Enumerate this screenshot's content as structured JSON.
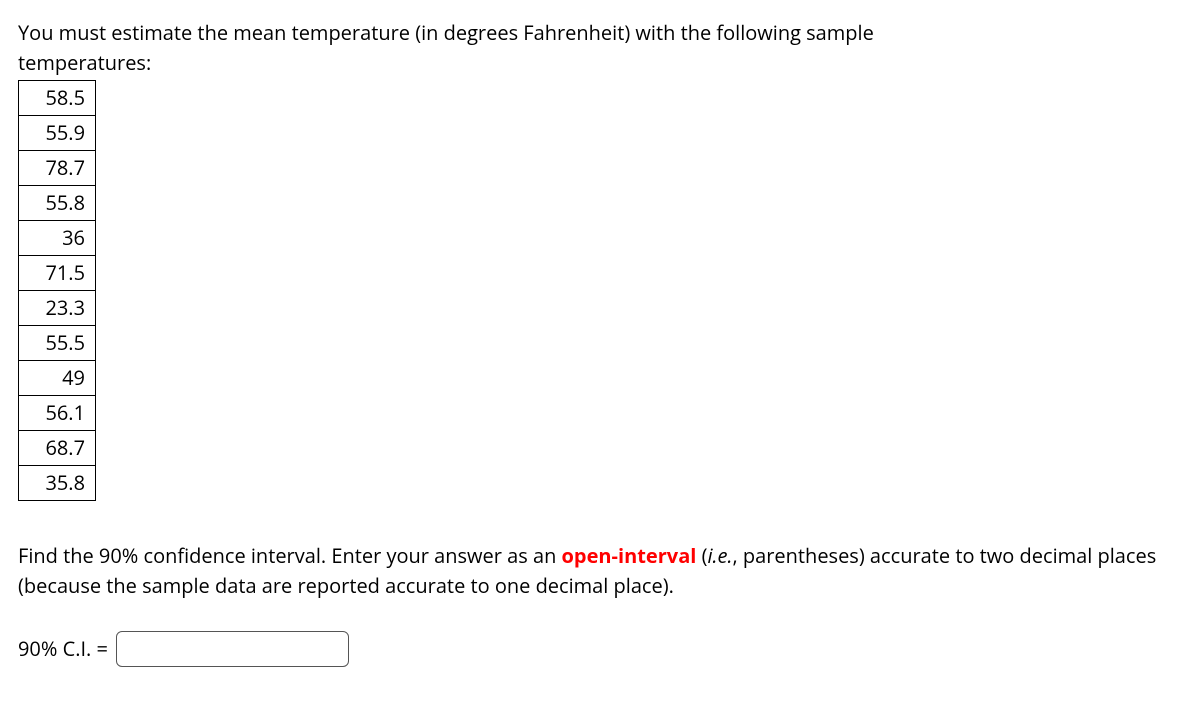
{
  "intro_line1": "You must estimate the mean temperature (in degrees Fahrenheit) with the following sample",
  "intro_line2": "temperatures:",
  "temperatures": [
    "58.5",
    "55.9",
    "78.7",
    "55.8",
    "36",
    "71.5",
    "23.3",
    "55.5",
    "49",
    "56.1",
    "68.7",
    "35.8"
  ],
  "instructions_prefix": "Find the 90% confidence interval. Enter your answer as an ",
  "open_interval_text": "open-interval",
  "instructions_mid1": " (",
  "ie_text": "i.e.",
  "instructions_mid2": ", parentheses) accurate to two decimal places (because the sample data are reported accurate to one decimal place).",
  "answer_label": "90% C.I. =",
  "answer_value": ""
}
